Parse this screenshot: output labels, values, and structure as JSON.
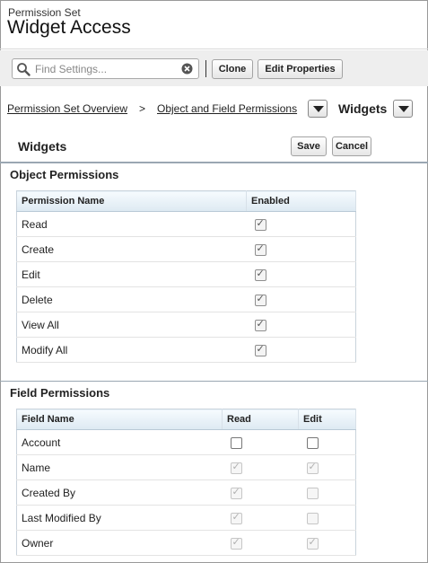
{
  "header": {
    "eyebrow": "Permission Set",
    "title": "Widget Access"
  },
  "toolbar": {
    "search_placeholder": "Find Settings...",
    "clone_label": "Clone",
    "edit_properties_label": "Edit Properties"
  },
  "breadcrumb": {
    "overview": "Permission Set Overview",
    "separator": ">",
    "object_field": "Object and Field Permissions",
    "current": "Widgets"
  },
  "panel": {
    "title": "Widgets",
    "save_label": "Save",
    "cancel_label": "Cancel"
  },
  "object_permissions": {
    "title": "Object Permissions",
    "col_name": "Permission Name",
    "col_enabled": "Enabled",
    "rows": [
      {
        "name": "Read",
        "enabled": true
      },
      {
        "name": "Create",
        "enabled": true
      },
      {
        "name": "Edit",
        "enabled": true
      },
      {
        "name": "Delete",
        "enabled": true
      },
      {
        "name": "View All",
        "enabled": true
      },
      {
        "name": "Modify All",
        "enabled": true
      }
    ]
  },
  "field_permissions": {
    "title": "Field Permissions",
    "col_field": "Field Name",
    "col_read": "Read",
    "col_edit": "Edit",
    "rows": [
      {
        "name": "Account",
        "read": false,
        "read_disabled": false,
        "edit": false,
        "edit_disabled": false
      },
      {
        "name": "Name",
        "read": true,
        "read_disabled": true,
        "edit": true,
        "edit_disabled": true
      },
      {
        "name": "Created By",
        "read": true,
        "read_disabled": true,
        "edit": false,
        "edit_disabled": true
      },
      {
        "name": "Last Modified By",
        "read": true,
        "read_disabled": true,
        "edit": false,
        "edit_disabled": true
      },
      {
        "name": "Owner",
        "read": true,
        "read_disabled": true,
        "edit": true,
        "edit_disabled": true
      }
    ]
  }
}
